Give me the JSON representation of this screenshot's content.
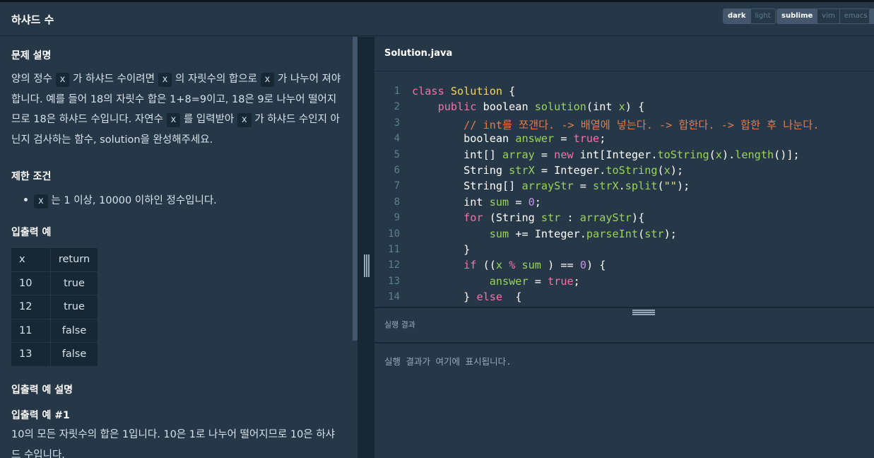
{
  "header": {
    "title": "하샤드 수",
    "theme_options": [
      "dark",
      "light"
    ],
    "theme_selected": "dark",
    "keymap_options": [
      "sublime",
      "vim",
      "emacs"
    ],
    "keymap_selected": "sublime"
  },
  "problem": {
    "desc_heading": "문제 설명",
    "desc": [
      {
        "t": "text",
        "v": "양의 정수 "
      },
      {
        "t": "code",
        "v": "x"
      },
      {
        "t": "text",
        "v": " 가 하샤드 수이려면 "
      },
      {
        "t": "code",
        "v": "x"
      },
      {
        "t": "text",
        "v": " 의 자릿수의 합으로 "
      },
      {
        "t": "code",
        "v": "x"
      },
      {
        "t": "text",
        "v": " 가 나누어 져야 합니다. 예를 들어 18의 자릿수 합은 1+8=9이고, 18은 9로 나누어 떨어지므로 18은 하샤드 수입니다. 자연수 "
      },
      {
        "t": "code",
        "v": "x"
      },
      {
        "t": "text",
        "v": " 를 입력받아 "
      },
      {
        "t": "code",
        "v": "x"
      },
      {
        "t": "text",
        "v": " 가 하샤드 수인지 아닌지 검사하는 함수, solution을 완성해주세요."
      }
    ],
    "constraints_heading": "제한 조건",
    "constraint_code": "x",
    "constraint_text": " 는 1 이상, 10000 이하인 정수입니다.",
    "io_heading": "입출력 예",
    "io_table": {
      "headers": [
        "x",
        "return"
      ],
      "rows": [
        [
          "10",
          "true"
        ],
        [
          "12",
          "true"
        ],
        [
          "11",
          "false"
        ],
        [
          "13",
          "false"
        ]
      ]
    },
    "io_explain_heading": "입출력 예 설명",
    "example1_heading": "입출력 예 #1",
    "example1_text": "10의 모든 자릿수의 합은 1입니다. 10은 1로 나누어 떨어지므로 10은 하샤드 수입니다."
  },
  "editor": {
    "filename": "Solution.java",
    "lines": [
      [
        [
          "kw",
          "class "
        ],
        [
          "ty",
          "Solution "
        ],
        [
          "kb",
          "{"
        ]
      ],
      [
        [
          "kb",
          "    "
        ],
        [
          "kw",
          "public "
        ],
        [
          "kb",
          "boolean "
        ],
        [
          "fn",
          "solution"
        ],
        [
          "kb",
          "("
        ],
        [
          "kb",
          "int "
        ],
        [
          "var",
          "x"
        ],
        [
          "kb",
          ") {"
        ]
      ],
      [
        [
          "cm",
          "        // int를 쪼갠다. -> 배열에 넣는다. -> 합한다. -> 합한 후 나눈다."
        ]
      ],
      [
        [
          "kb",
          "        boolean "
        ],
        [
          "var",
          "answer"
        ],
        [
          "kb",
          " = "
        ],
        [
          "kw",
          "true"
        ],
        [
          "kb",
          ";"
        ]
      ],
      [
        [
          "kb",
          "        int[] "
        ],
        [
          "var",
          "array"
        ],
        [
          "kb",
          " = "
        ],
        [
          "kw",
          "new "
        ],
        [
          "kb",
          "int[Integer."
        ],
        [
          "fn",
          "toString"
        ],
        [
          "kb",
          "("
        ],
        [
          "var",
          "x"
        ],
        [
          "kb",
          ")."
        ],
        [
          "fn",
          "length"
        ],
        [
          "kb",
          "()];"
        ]
      ],
      [
        [
          "kb",
          "        String "
        ],
        [
          "var",
          "strX"
        ],
        [
          "kb",
          " = Integer."
        ],
        [
          "fn",
          "toString"
        ],
        [
          "kb",
          "("
        ],
        [
          "var",
          "x"
        ],
        [
          "kb",
          ");"
        ]
      ],
      [
        [
          "kb",
          "        String[] "
        ],
        [
          "var",
          "arrayStr"
        ],
        [
          "kb",
          " = "
        ],
        [
          "var",
          "strX"
        ],
        [
          "kb",
          "."
        ],
        [
          "fn",
          "split"
        ],
        [
          "kb",
          "("
        ],
        [
          "str",
          "\"\""
        ],
        [
          "kb",
          ");"
        ]
      ],
      [
        [
          "kb",
          "        int "
        ],
        [
          "var",
          "sum"
        ],
        [
          "kb",
          " = "
        ],
        [
          "num",
          "0"
        ],
        [
          "kb",
          ";"
        ]
      ],
      [
        [
          "kb",
          "        "
        ],
        [
          "kw",
          "for "
        ],
        [
          "kb",
          "(String "
        ],
        [
          "var",
          "str"
        ],
        [
          "kb",
          " : "
        ],
        [
          "var",
          "arrayStr"
        ],
        [
          "kb",
          "){"
        ]
      ],
      [
        [
          "kb",
          "            "
        ],
        [
          "var",
          "sum"
        ],
        [
          "kb",
          " += Integer."
        ],
        [
          "fn",
          "parseInt"
        ],
        [
          "kb",
          "("
        ],
        [
          "var",
          "str"
        ],
        [
          "kb",
          ");"
        ]
      ],
      [
        [
          "kb",
          "        }"
        ]
      ],
      [
        [
          "kb",
          "        "
        ],
        [
          "kw",
          "if "
        ],
        [
          "kb",
          "(("
        ],
        [
          "var",
          "x"
        ],
        [
          "kb",
          " "
        ],
        [
          "kw",
          "%"
        ],
        [
          "kb",
          " "
        ],
        [
          "var",
          "sum"
        ],
        [
          "kb",
          " ) == "
        ],
        [
          "num",
          "0"
        ],
        [
          "kb",
          ") {"
        ]
      ],
      [
        [
          "kb",
          "            "
        ],
        [
          "var",
          "answer"
        ],
        [
          "kb",
          " = "
        ],
        [
          "kw",
          "true"
        ],
        [
          "kb",
          ";"
        ]
      ],
      [
        [
          "kb",
          "        } "
        ],
        [
          "kw",
          "else  "
        ],
        [
          "kb",
          "{"
        ]
      ]
    ]
  },
  "result": {
    "title": "실행 결과",
    "placeholder": "실행 결과가 여기에 표시됩니다."
  }
}
